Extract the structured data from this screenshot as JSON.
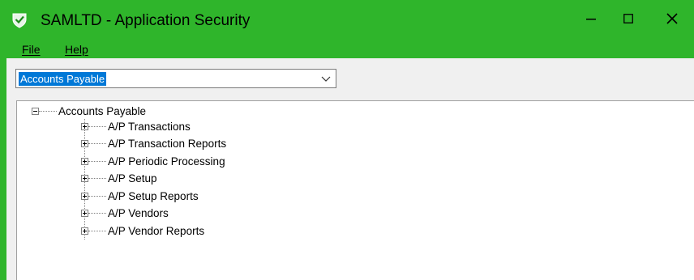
{
  "window": {
    "title": "SAMLTD - Application Security",
    "colors": {
      "titlebar": "#2fb52b",
      "selection": "#0078d7"
    }
  },
  "controls": {
    "minimize_icon": "minimize-icon",
    "maximize_icon": "maximize-icon",
    "close_icon": "close-icon"
  },
  "menu": {
    "file": "File",
    "help": "Help"
  },
  "module_select": {
    "value": "Accounts Payable"
  },
  "tree": {
    "root": {
      "label": "Accounts Payable",
      "expanded": true,
      "children": [
        {
          "label": "A/P Transactions"
        },
        {
          "label": "A/P Transaction Reports"
        },
        {
          "label": "A/P Periodic Processing"
        },
        {
          "label": "A/P Setup"
        },
        {
          "label": "A/P Setup Reports"
        },
        {
          "label": "A/P Vendors"
        },
        {
          "label": "A/P Vendor Reports"
        }
      ]
    }
  }
}
